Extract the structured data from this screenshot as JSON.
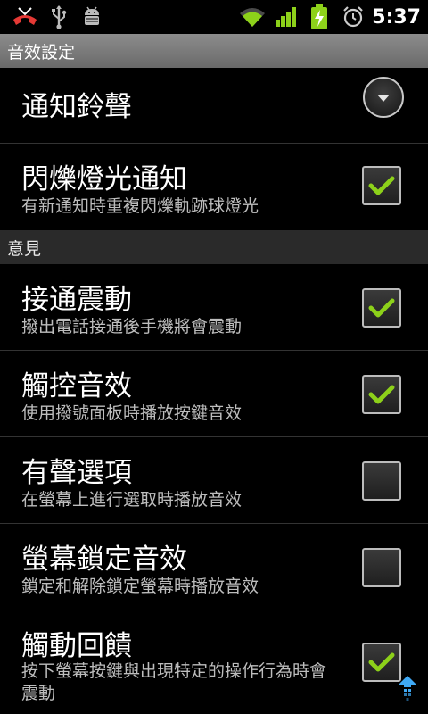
{
  "status_bar": {
    "time": "5:37",
    "icons": [
      "missed-call-icon",
      "usb-icon",
      "android-debug-icon",
      "wifi-icon",
      "signal-icon",
      "battery-charging-icon",
      "alarm-icon"
    ]
  },
  "section_sound": {
    "header": "音效設定",
    "notification_ringtone": {
      "title": "通知鈴聲"
    },
    "pulse_light": {
      "title": "閃爍燈光通知",
      "summary": "有新通知時重複閃爍軌跡球燈光",
      "checked": true
    }
  },
  "section_feedback": {
    "header": "意見",
    "items": [
      {
        "title": "接通震動",
        "summary": "撥出電話接通後手機將會震動",
        "checked": true
      },
      {
        "title": "觸控音效",
        "summary": "使用撥號面板時播放按鍵音效",
        "checked": true
      },
      {
        "title": "有聲選項",
        "summary": "在螢幕上進行選取時播放音效",
        "checked": false
      },
      {
        "title": "螢幕鎖定音效",
        "summary": "鎖定和解除鎖定螢幕時播放音效",
        "checked": false
      },
      {
        "title": "觸動回饋",
        "summary": "按下螢幕按鍵與出現特定的操作行為時會震動",
        "checked": true
      }
    ]
  },
  "colors": {
    "check_green": "#8dd11a",
    "background": "#000000",
    "summary_text": "#bdbdbd"
  }
}
